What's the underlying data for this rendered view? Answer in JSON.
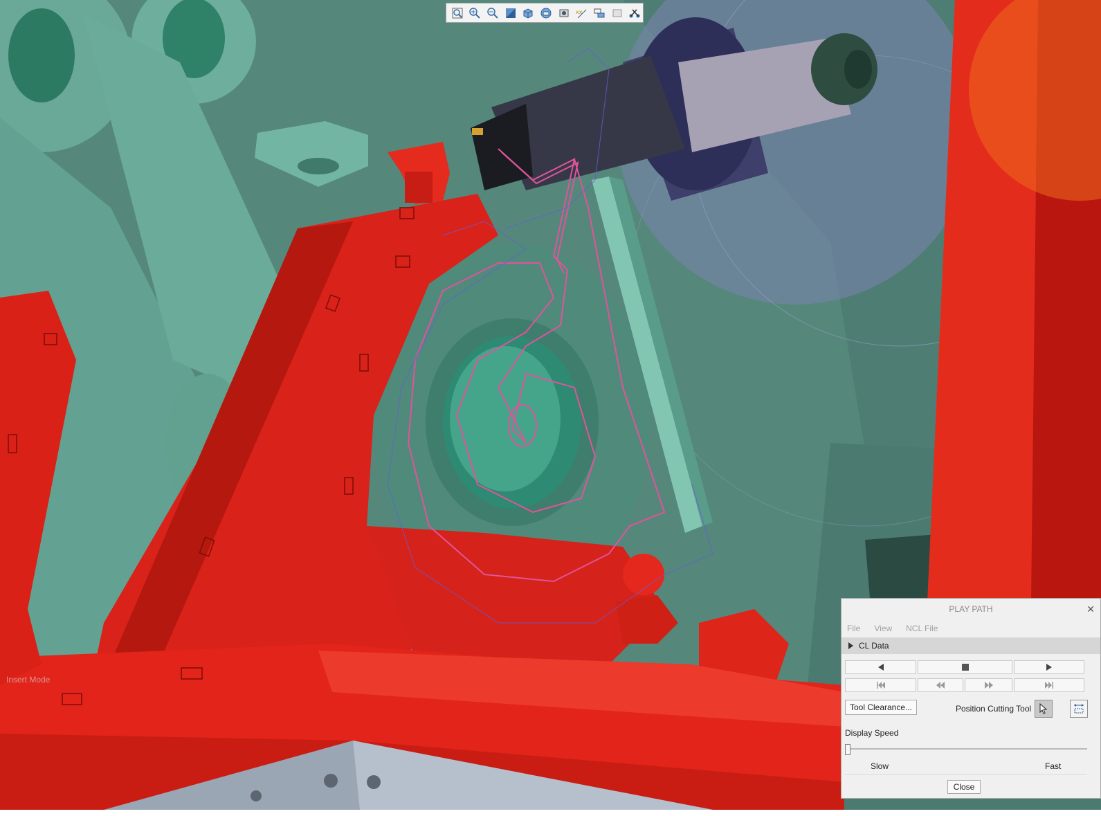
{
  "viewport": {
    "mode_text": "Insert Mode",
    "toolbar_icons": [
      "zoom-fit-icon",
      "zoom-in-icon",
      "zoom-out-icon",
      "zoom-window-icon",
      "view-orientation-icon",
      "display-style-icon",
      "saved-views-icon",
      "datum-display-icon",
      "spin-center-icon",
      "annotation-display-icon",
      "appearance-icon"
    ],
    "colors": {
      "background": "#4f7f74",
      "part_red": "#e21e16",
      "part_teal": "#6fae9d",
      "toolpath": "#e0549b",
      "tool_dark": "#3b3f4e"
    }
  },
  "play_path": {
    "title": "PLAY PATH",
    "menu": [
      "File",
      "View",
      "NCL File"
    ],
    "cl_data_label": "CL Data",
    "playback_row1": [
      "play-backward-icon",
      "stop-icon",
      "play-forward-icon"
    ],
    "playback_row2": [
      "go-to-start-icon",
      "step-back-icon",
      "step-forward-icon",
      "go-to-end-icon"
    ],
    "tool_clearance_label": "Tool Clearance...",
    "position_cutting_tool_label": "Position Cutting Tool",
    "display_speed_label": "Display Speed",
    "speed_value": 0.0,
    "slow_label": "Slow",
    "fast_label": "Fast",
    "close_label": "Close"
  }
}
